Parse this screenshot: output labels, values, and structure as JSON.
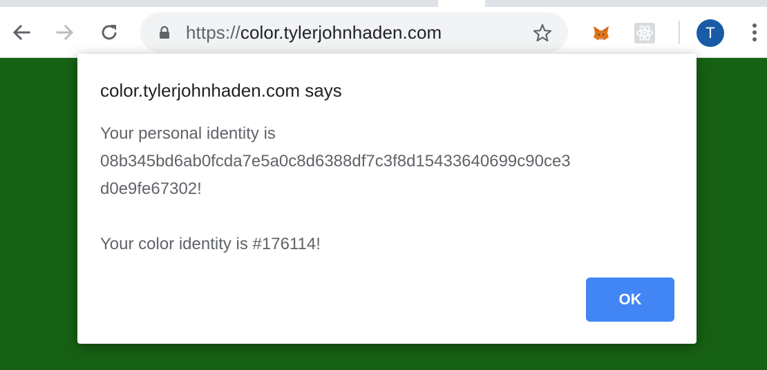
{
  "browser": {
    "url_scheme": "https://",
    "url_host": "color.tylerjohnhaden.com",
    "profile_initial": "T"
  },
  "icons": {
    "back": "back-arrow-icon",
    "forward": "forward-arrow-icon",
    "reload": "reload-icon",
    "lock": "lock-icon",
    "star": "star-icon",
    "extension_1": "metamask-fox-icon",
    "extension_2": "react-icon",
    "menu": "kebab-menu-icon"
  },
  "dialog": {
    "title": "color.tylerjohnhaden.com says",
    "message_lines": [
      "Your personal identity is",
      "08b345bd6ab0fcda7e5a0c8d6388df7c3f8d15433640699c90ce3",
      "d0e9fe67302!",
      "Your color identity is #176114!"
    ],
    "ok_label": "OK"
  },
  "colors": {
    "page_background": "#176114",
    "ok_button": "#4285f4",
    "avatar": "#1a5ba6"
  }
}
